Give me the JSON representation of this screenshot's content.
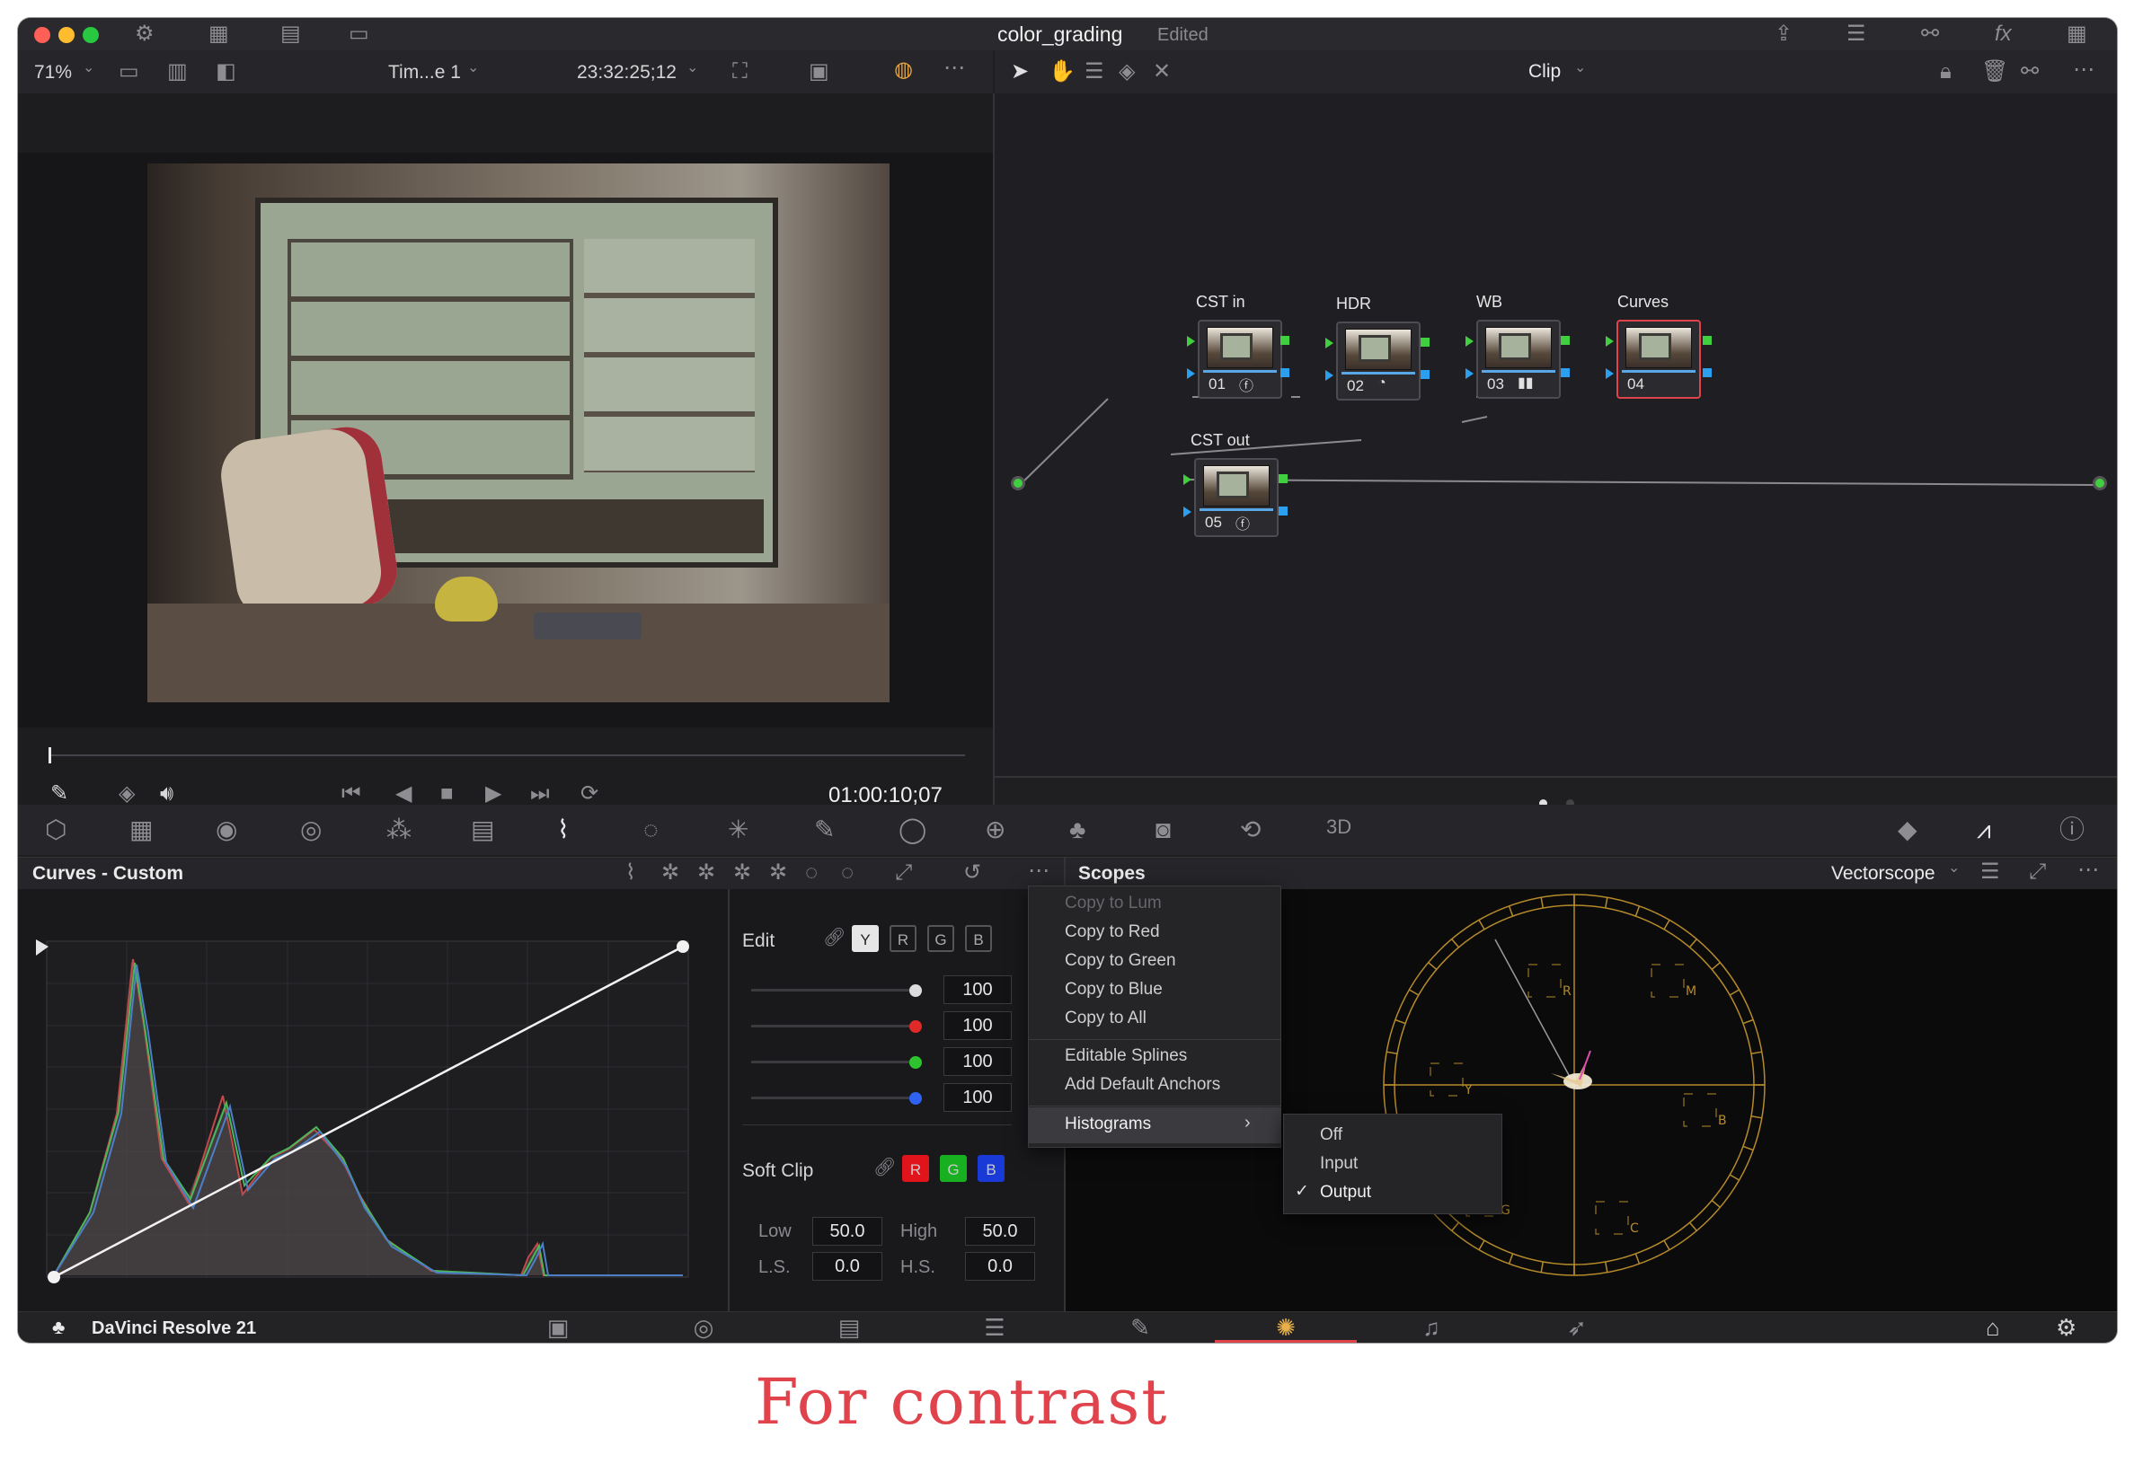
{
  "window": {
    "title": "color_grading",
    "status": "Edited"
  },
  "viewer": {
    "zoom": "71%",
    "timeline_name": "Tim...e 1",
    "source_timecode": "23:32:25;12",
    "playhead_timecode": "01:00:10;07"
  },
  "node_editor": {
    "mode": "Clip",
    "nodes": [
      {
        "title": "CST in",
        "number": "01",
        "icon": "fx-icon"
      },
      {
        "title": "HDR",
        "number": "02",
        "icon": "hdr-icon"
      },
      {
        "title": "WB",
        "number": "03",
        "icon": "bars-icon"
      },
      {
        "title": "Curves",
        "number": "04",
        "icon": ""
      },
      {
        "title": "CST out",
        "number": "05",
        "icon": "fx-icon"
      }
    ]
  },
  "curves_panel": {
    "title": "Curves - Custom",
    "edit_label": "Edit",
    "channels": [
      "Y",
      "R",
      "G",
      "B"
    ],
    "intensity": [
      "100",
      "100",
      "100",
      "100"
    ],
    "soft_clip_label": "Soft Clip",
    "soft_clip_channels": [
      "R",
      "G",
      "B"
    ],
    "low_label": "Low",
    "low_value": "50.0",
    "high_label": "High",
    "high_value": "50.0",
    "ls_label": "L.S.",
    "ls_value": "0.0",
    "hs_label": "H.S.",
    "hs_value": "0.0"
  },
  "context_menu": {
    "items": [
      "Copy to Lum",
      "Copy to Red",
      "Copy to Green",
      "Copy to Blue",
      "Copy to All"
    ],
    "spline_items": [
      "Editable Splines",
      "Add Default Anchors"
    ],
    "histograms_label": "Histograms",
    "histograms_options": [
      "Off",
      "Input",
      "Output"
    ],
    "histograms_selected": "Output"
  },
  "scopes": {
    "title": "Scopes",
    "mode": "Vectorscope",
    "targets": [
      "R",
      "M",
      "Y",
      "B",
      "G",
      "C"
    ]
  },
  "footer": {
    "app_name": "DaVinci Resolve 21",
    "active_page": "color"
  },
  "caption": "For contrast",
  "colors": {
    "accent_red": "#e0434b",
    "node_green": "#3fcf3f",
    "node_blue": "#2b9ff0",
    "scope_graticule": "#b58a2a"
  }
}
